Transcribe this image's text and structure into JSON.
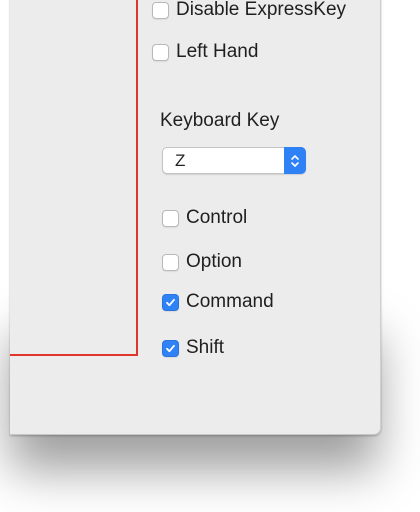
{
  "options": {
    "disable_expresskey": {
      "label": "Disable ExpressKey",
      "checked": false
    },
    "left_hand": {
      "label": "Left Hand",
      "checked": false
    }
  },
  "keyboard_key": {
    "title": "Keyboard Key",
    "selected": "Z"
  },
  "modifiers": [
    {
      "label": "Control",
      "checked": false
    },
    {
      "label": "Option",
      "checked": false
    },
    {
      "label": "Command",
      "checked": true
    },
    {
      "label": "Shift",
      "checked": true
    }
  ],
  "colors": {
    "accent": "#2f82f6",
    "highlight_outline": "#e0352b",
    "window_bg": "#ececec"
  }
}
